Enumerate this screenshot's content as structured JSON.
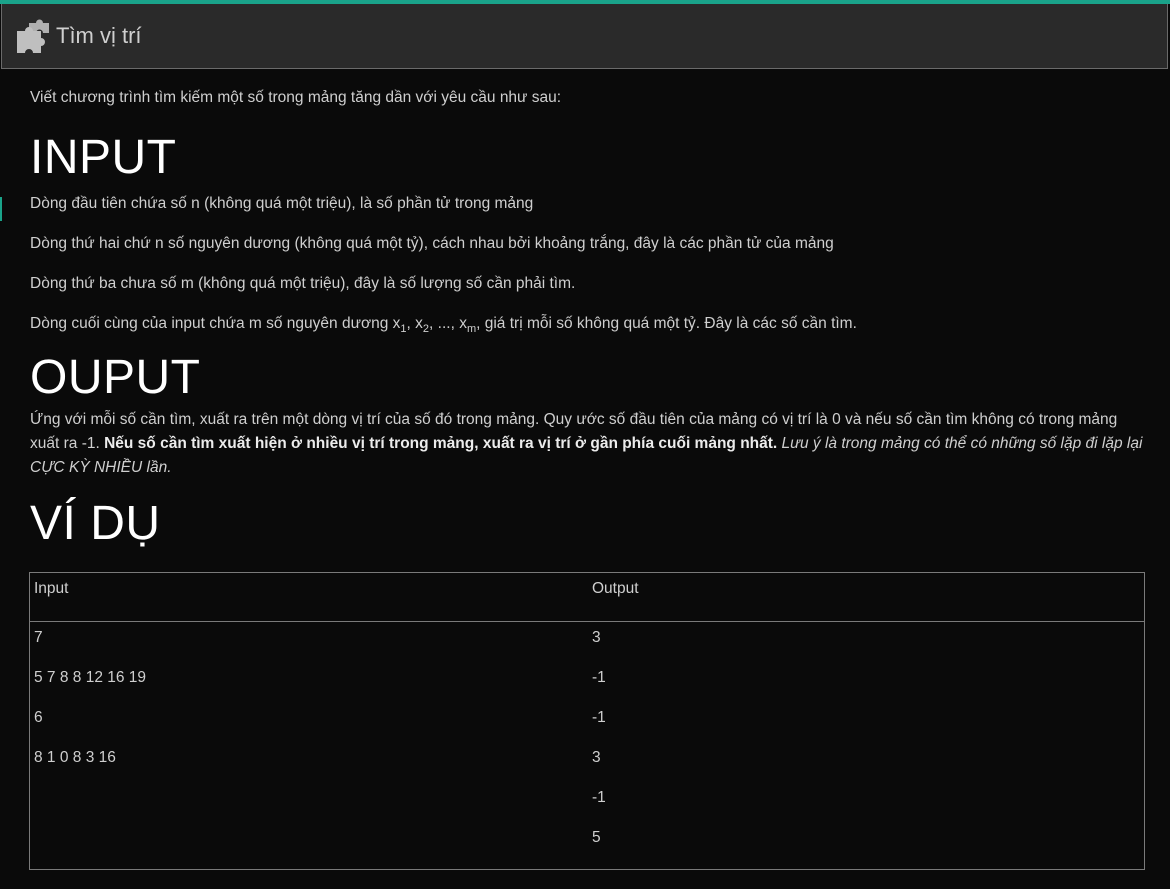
{
  "header": {
    "title": "Tìm vị trí",
    "icon": "puzzle-icon"
  },
  "intro": "Viết chương trình tìm kiếm một số trong mảng tăng dần với yêu cầu như sau:",
  "input_section": {
    "heading": "INPUT",
    "lines": [
      "Dòng đầu tiên chứa số n (không quá một triệu), là số phần tử trong mảng",
      "Dòng thứ hai chứ n số nguyên dương (không quá một tỷ), cách nhau bởi khoảng trắng, đây là các phần tử của mảng",
      "Dòng thứ ba chưa số m (không quá một triệu), đây là số lượng số cần phải tìm."
    ],
    "last_line": {
      "prefix": "Dòng cuối cùng của input chứa m số nguyên dương x",
      "sub1": "1",
      "sep1": ", x",
      "sub2": "2",
      "sep2": ", ..., x",
      "subm": "m",
      "suffix": ", giá trị mỗi số không quá một tỷ. Đây là các số cần tìm."
    }
  },
  "output_section": {
    "heading": "OUPUT",
    "text_plain": "Ứng với mỗi số cần tìm, xuất ra trên một dòng vị trí của số đó trong mảng. Quy ước số đầu tiên của mảng có vị trí là 0 và nếu số cần tìm không có trong mảng xuất ra -1. ",
    "text_bold": "Nếu số cần tìm xuất hiện ở nhiều vị trí trong mảng, xuất ra vị trí ở gần phía cuối mảng nhất.",
    "text_italic": " Lưu ý là trong mảng có thể có những số lặp đi lặp lại CỰC KỲ NHIỀU lần."
  },
  "example_section": {
    "heading": "VÍ DỤ",
    "col_input": "Input",
    "col_output": "Output",
    "input_lines": [
      "7",
      "5 7 8 8 12 16 19",
      "6",
      "8 1 0 8 3 16"
    ],
    "output_lines": [
      "3",
      "-1",
      "-1",
      "3",
      "-1",
      "5"
    ]
  },
  "colors": {
    "accent": "#1aa38a",
    "background": "#0a0a0a",
    "header_bg": "#2a2a2a"
  }
}
